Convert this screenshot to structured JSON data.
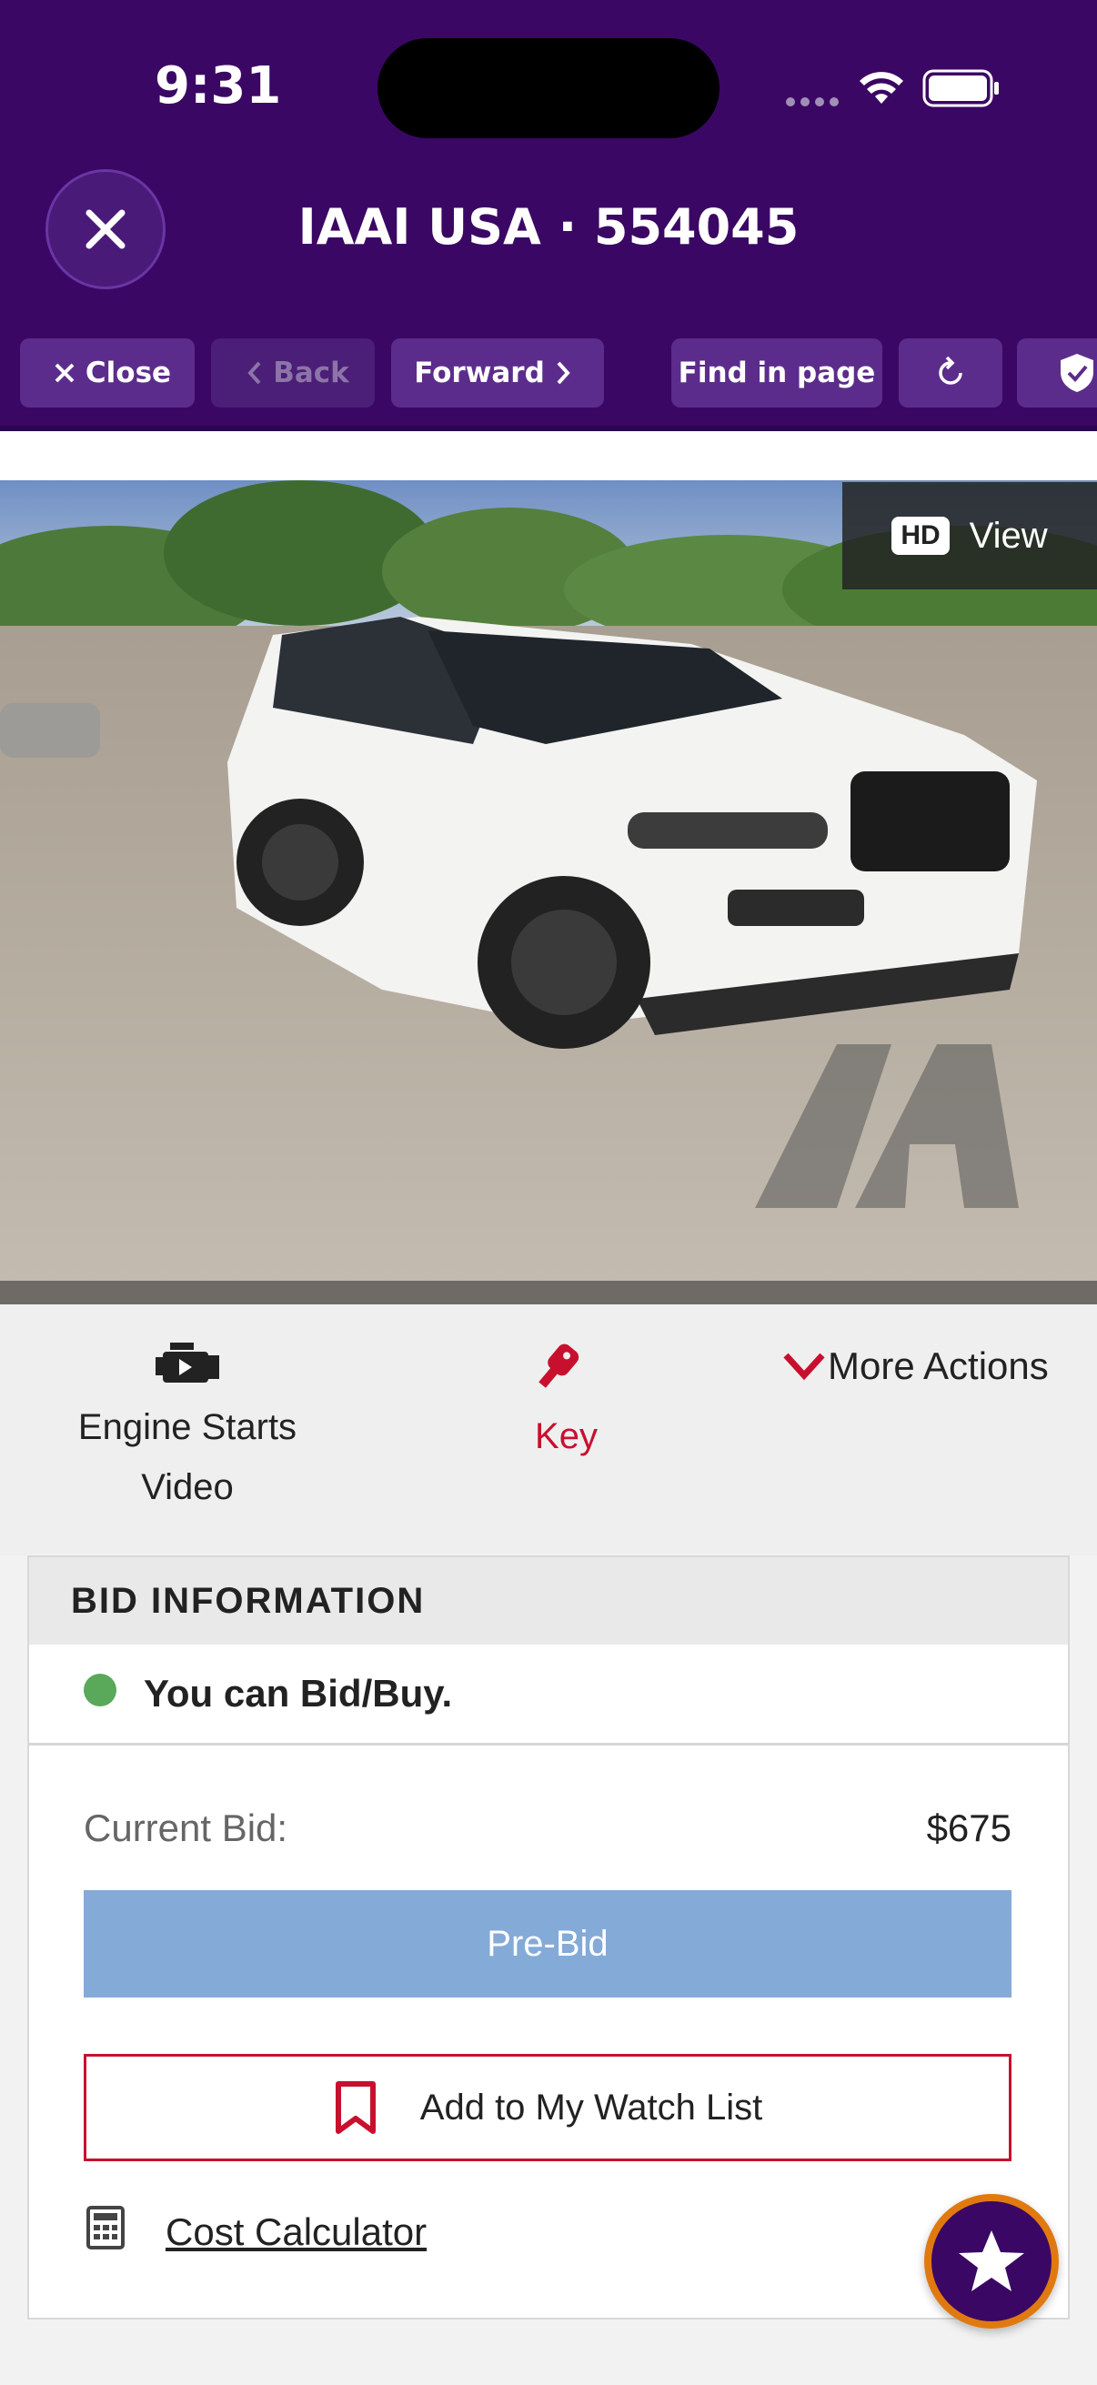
{
  "status_bar": {
    "time": "9:31"
  },
  "header": {
    "title": "IAAI USA · 554045",
    "toolbar": {
      "close_label": "Close",
      "back_label": "Back",
      "forward_label": "Forward",
      "find_label": "Find in page"
    }
  },
  "photo": {
    "hd_badge": "HD",
    "view_label": "View",
    "watermark": "IAA"
  },
  "actions": {
    "engine_line1": "Engine Starts",
    "engine_line2": "Video",
    "key_label": "Key",
    "more_label": "More Actions"
  },
  "bid": {
    "section_title": "BID INFORMATION",
    "status_text": "You can Bid/Buy.",
    "current_bid_label": "Current Bid:",
    "current_bid_value": "$675",
    "prebid_label": "Pre-Bid",
    "watch_label": "Add to My Watch List",
    "calculator_label": "Cost Calculator"
  },
  "colors": {
    "header": "#3b0764",
    "accent_red": "#c8102e",
    "prebid_blue": "#84aad8",
    "fab_ring": "#e07a10",
    "status_green": "#5aa85a"
  }
}
